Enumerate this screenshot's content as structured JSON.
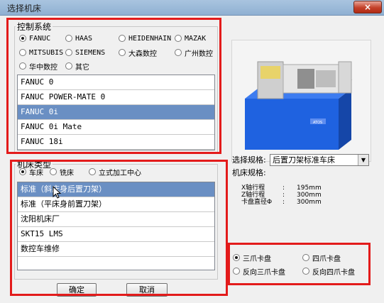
{
  "window": {
    "title": "选择机床",
    "close_label": "×"
  },
  "control_system": {
    "title": "控制系统",
    "options": [
      {
        "label": "FANUC",
        "checked": true
      },
      {
        "label": "HAAS",
        "checked": false
      },
      {
        "label": "HEIDENHAIN",
        "checked": false
      },
      {
        "label": "MAZAK",
        "checked": false
      },
      {
        "label": "MITSUBIS",
        "checked": false
      },
      {
        "label": "SIEMENS",
        "checked": false
      },
      {
        "label": "大森数控",
        "checked": false
      },
      {
        "label": "广州数控",
        "checked": false
      },
      {
        "label": "华中数控",
        "checked": false
      },
      {
        "label": "其它",
        "checked": false
      }
    ],
    "list": [
      "FANUC 0",
      "FANUC POWER-MATE 0",
      "FANUC 0i",
      "FANUC 0i Mate",
      "FANUC 18i"
    ],
    "selected_index": 2
  },
  "machine_type": {
    "title": "机床类型",
    "options": [
      {
        "label": "车床",
        "checked": true
      },
      {
        "label": "铣床",
        "checked": false
      },
      {
        "label": "立式加工中心",
        "checked": false
      }
    ],
    "list": [
      "标准（斜床身后置刀架）",
      "标准（平床身前置刀架）",
      "沈阳机床厂",
      "SKT15 LMS",
      "数控车维修"
    ],
    "selected_index": 0
  },
  "spec": {
    "select_label": "选择规格:",
    "selected_value": "后置刀架标准车床",
    "machine_spec_label": "机床规格:",
    "rows": [
      {
        "name": "X轴行程",
        "sep": ":",
        "value": "195mm"
      },
      {
        "name": "Z轴行程",
        "sep": ":",
        "value": "300mm"
      },
      {
        "name": "卡盘直径Φ",
        "sep": ":",
        "value": "300mm"
      }
    ]
  },
  "chuck": {
    "options": [
      {
        "label": "三爪卡盘",
        "checked": true
      },
      {
        "label": "四爪卡盘",
        "checked": false
      },
      {
        "label": "反向三爪卡盘",
        "checked": false
      },
      {
        "label": "反向四爪卡盘",
        "checked": false
      }
    ]
  },
  "buttons": {
    "ok": "确定",
    "cancel": "取消"
  },
  "preview": {
    "plate_text": "ATOS"
  },
  "colors": {
    "highlight": "#6a8fc3",
    "annotation": "#e31b1b",
    "machine_body": "#1f62e0"
  }
}
